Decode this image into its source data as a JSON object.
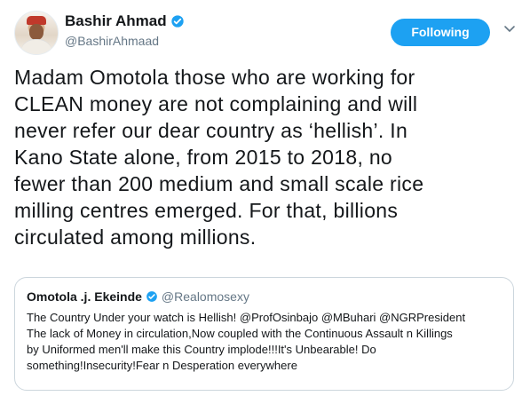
{
  "author": {
    "name": "Bashir Ahmad",
    "handle": "@BashirAhmaad",
    "follow_label": "Following"
  },
  "tweet": {
    "text": "Madam Omotola those who are working for\nCLEAN money are not complaining and will\nnever refer our dear country as ‘hellish’. In\nKano State alone, from 2015 to 2018, no\nfewer than 200 medium and small scale rice\nmilling centres emerged. For that, billions\ncirculated among millions."
  },
  "quoted_tweet": {
    "name": "Omotola .j. Ekeinde",
    "handle": "@Realomosexy",
    "text": "The Country Under your watch is Hellish! @ProfOsinbajo @MBuhari @NGRPresident\nThe lack of Money in circulation,Now coupled with the Continuous Assault n Killings\nby Uniformed men'll make this Country implode!!!It's Unbearable! Do\nsomething!Insecurity!Fear n Desperation everywhere"
  },
  "colors": {
    "accent": "#1da1f2",
    "text": "#14171a",
    "secondary": "#657786",
    "border": "#ccd6dd"
  },
  "icons": {
    "verified": "verified-badge-icon",
    "caret": "chevron-down-icon"
  }
}
